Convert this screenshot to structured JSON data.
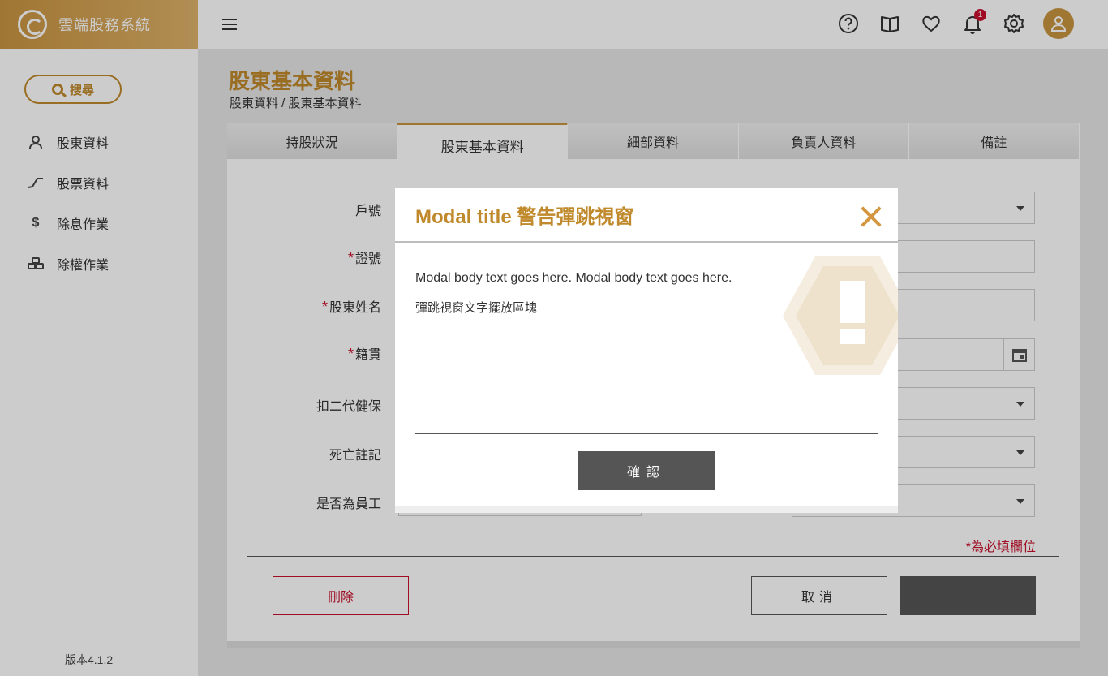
{
  "app": {
    "brand_title": "雲端股務系統",
    "version": "版本4.1.2"
  },
  "sidebar": {
    "search_label": "搜尋",
    "items": [
      {
        "label": "股東資料",
        "icon": "user-icon"
      },
      {
        "label": "股票資料",
        "icon": "chart-line-icon"
      },
      {
        "label": "除息作業",
        "icon": "dollar-icon"
      },
      {
        "label": "除權作業",
        "icon": "coins-icon"
      }
    ]
  },
  "topbar": {
    "notification_count": "1"
  },
  "page": {
    "title": "股東基本資料",
    "breadcrumb": "股東資料 / 股東基本資料"
  },
  "tabs": [
    {
      "label": "持股狀況",
      "active": false
    },
    {
      "label": "股東基本資料",
      "active": true
    },
    {
      "label": "細部資料",
      "active": false
    },
    {
      "label": "負責人資料",
      "active": false
    },
    {
      "label": "備註",
      "active": false
    }
  ],
  "form": {
    "fields": [
      {
        "label": "戶號",
        "required": false
      },
      {
        "label": "證號",
        "required": true
      },
      {
        "label": "股東姓名",
        "required": true
      },
      {
        "label": "籍貫",
        "required": true
      },
      {
        "label": "扣二代健保",
        "required": false
      },
      {
        "label": "死亡註記",
        "required": false
      },
      {
        "label": "是否為員工",
        "required": false
      }
    ],
    "required_mark": "*",
    "required_note": "為必填欄位",
    "delete_label": "刪除",
    "cancel_label": "取消",
    "save_label": ""
  },
  "modal": {
    "title": "Modal title 警告彈跳視窗",
    "body_text": "Modal body text goes here. Modal body text goes here.",
    "body_text_zh": "彈跳視窗文字擺放區塊",
    "confirm_label": "確認"
  },
  "colors": {
    "accent": "#c08a2c",
    "danger": "#c8102e",
    "dark_button": "#555555"
  }
}
